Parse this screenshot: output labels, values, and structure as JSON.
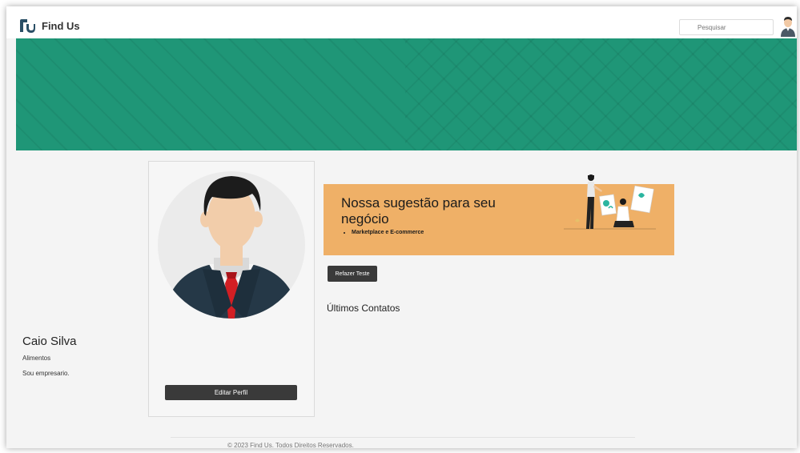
{
  "header": {
    "app_title": "Find Us",
    "search_placeholder": "Pesquisar"
  },
  "profile": {
    "name": "Caio Silva",
    "sector": "Alimentos",
    "bio": "Sou empresario.",
    "edit_button": "Editar Perfil"
  },
  "suggestion": {
    "title": "Nossa sugestão para seu negócio",
    "items": [
      "Marketplace e E-commerce"
    ]
  },
  "actions": {
    "retry_button": "Refazer Teste"
  },
  "contacts": {
    "heading": "Últimos Contatos"
  },
  "footer": {
    "copyright": "© 2023 Find Us. Todos Direitos Reservados."
  },
  "colors": {
    "banner": "#1f9677",
    "suggestion_bg": "#efb067",
    "button_dark": "#3a3a3a",
    "logo": "#2a4f66",
    "tie": "#d21f24",
    "suit": "#253847"
  },
  "icons": {
    "logo": "find-us-logo-icon",
    "avatar": "user-avatar-icon",
    "profile_photo": "businessman-avatar-icon",
    "illustration": "people-presentation-illustration"
  }
}
